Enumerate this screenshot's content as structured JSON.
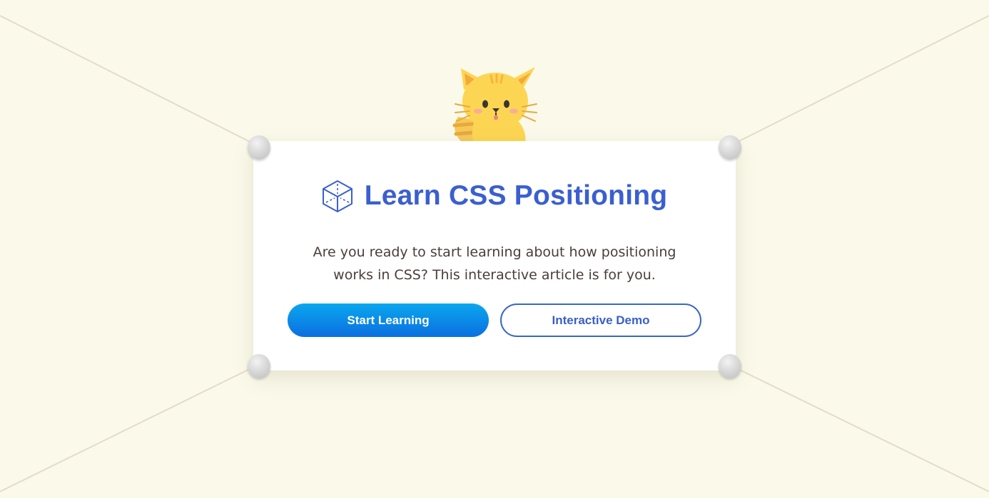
{
  "hero": {
    "title": "Learn CSS Positioning",
    "description": "Are you ready to start learning about how positioning works in CSS? This interactive article is for you.",
    "title_icon": "cube-icon",
    "mascot": "cat-mascot"
  },
  "actions": {
    "primary_label": "Start Learning",
    "secondary_label": "Interactive Demo"
  },
  "colors": {
    "background": "#fbf9ea",
    "title": "#3a5fd0",
    "primary_button": "#0b8ae8",
    "secondary_border": "#3a66c8"
  }
}
